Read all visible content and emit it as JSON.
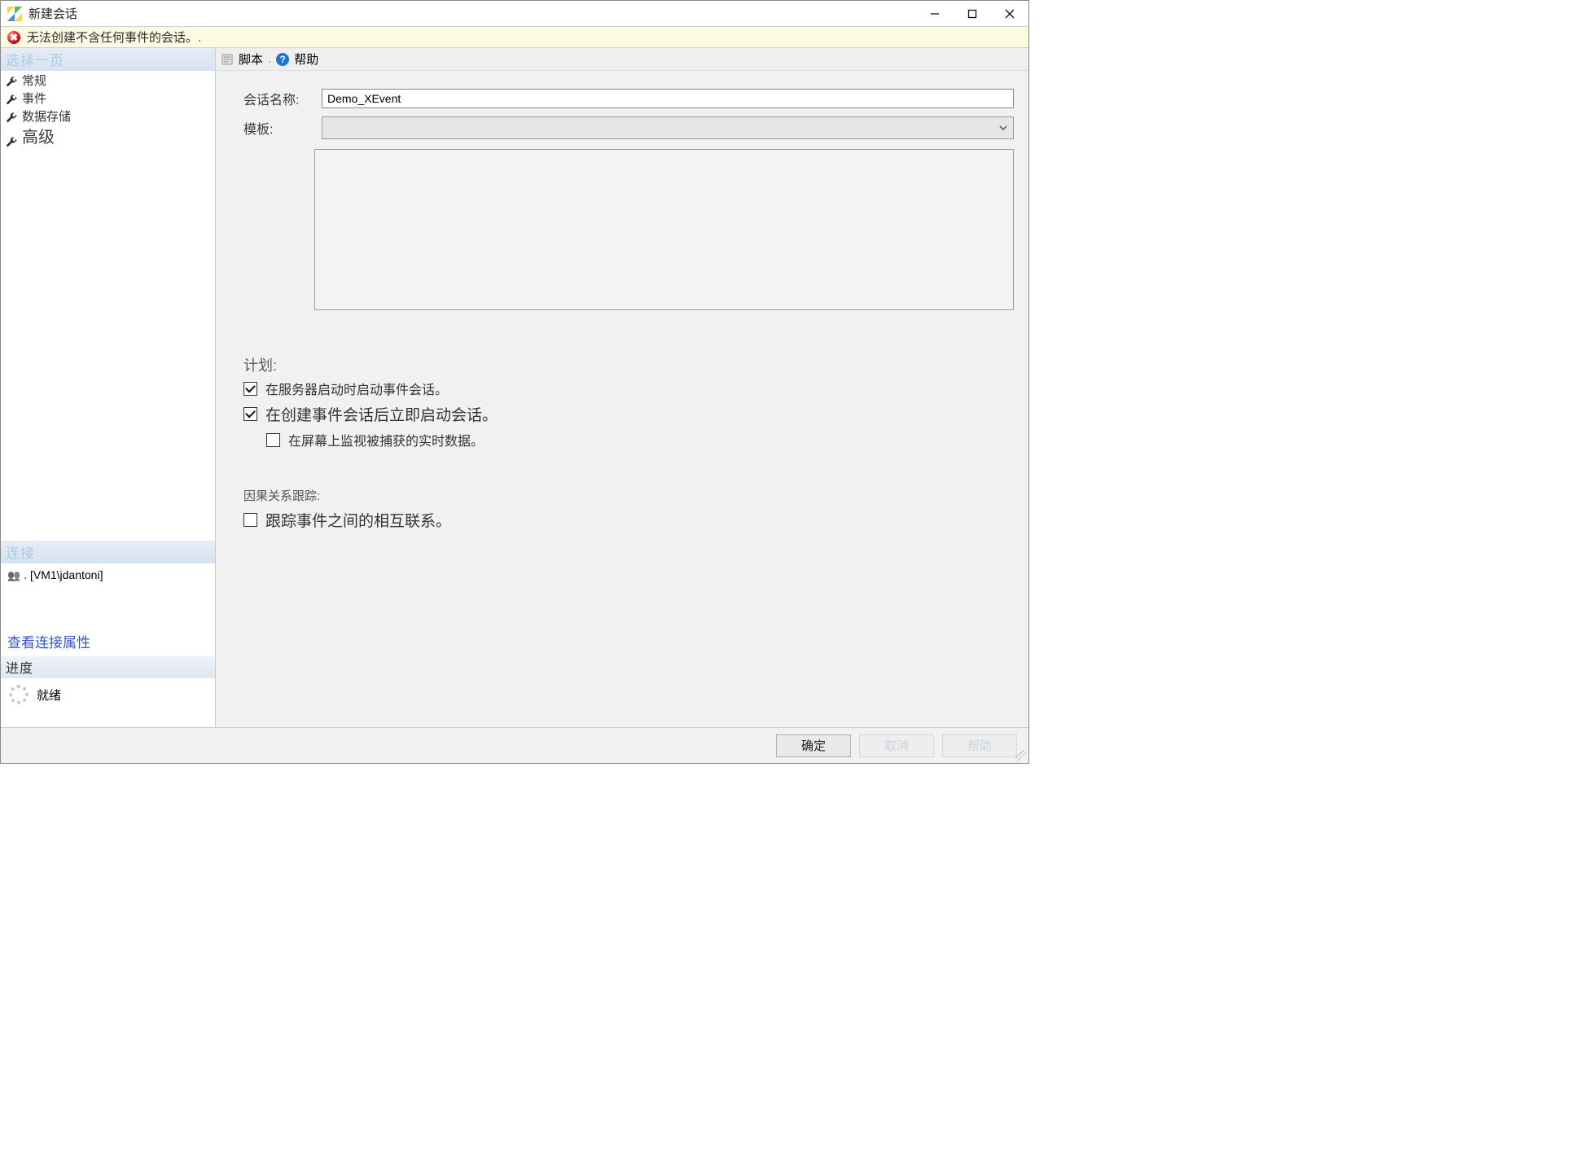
{
  "window": {
    "title": "新建会话"
  },
  "error": {
    "message": "无法创建不含任何事件的会话。."
  },
  "sidebar": {
    "select_header": "选择一页",
    "nav": [
      {
        "label": "常规"
      },
      {
        "label": "事件"
      },
      {
        "label": "数据存储"
      },
      {
        "label": "高级"
      }
    ],
    "connection_header": "连接",
    "connection_user": ". [VM1\\jdantoni]",
    "view_props_link": "查看连接属性",
    "progress_header": "进度",
    "progress_status": "就绪"
  },
  "toolbar": {
    "script_label": "脚本",
    "sep": ".",
    "help_label": "帮助"
  },
  "form": {
    "session_name_label": "会话名称:",
    "session_name_value": "Demo_XEvent",
    "template_label": "模板:",
    "template_placeholder": "",
    "plan_title": "计划:",
    "chk_start_on_server": "在服务器启动时启动事件会话。",
    "chk_start_immediately": "在创建事件会话后立即启动会话。",
    "chk_watch_live": "在屏幕上监视被捕获的实时数据。",
    "causality_title": "因果关系跟踪:",
    "chk_track_causality": "跟踪事件之间的相互联系。"
  },
  "footer": {
    "ok": "确定",
    "cancel": "取消",
    "help": "帮助"
  }
}
